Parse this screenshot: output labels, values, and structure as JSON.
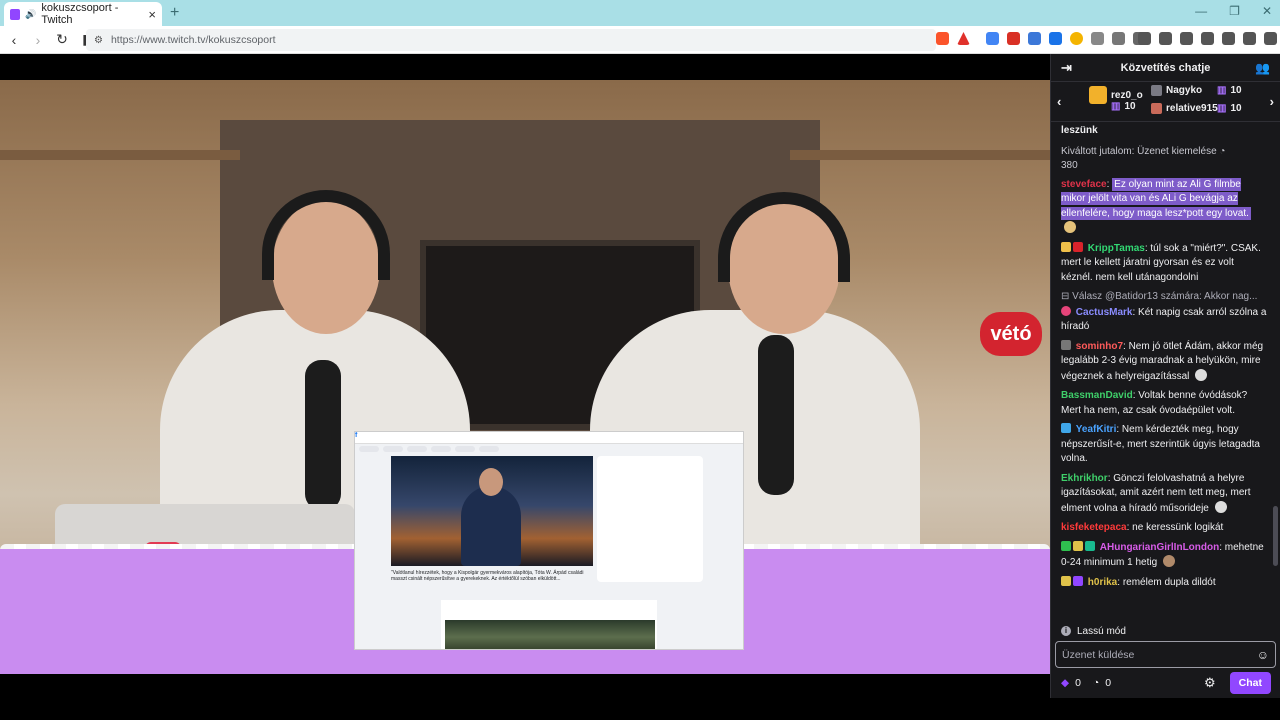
{
  "browser": {
    "tab_title": "kokuszcsoport - Twitch",
    "tab_close": "×",
    "new_tab": "+",
    "url": "https://www.twitch.tv/kokuszcsoport",
    "window_controls": [
      "—",
      "❐",
      "✕"
    ]
  },
  "video": {
    "veto_sign": "vétó",
    "share_brand": "f",
    "share_caption": "\"Valótlanul hírezzétek, hogy a Kispolgár gyermekváros alapítója, Tóta W. Árpád családi masszt csinált népszerűsítve a gyerekeknek. Az értéktőlül szóban elküldött..."
  },
  "chat": {
    "header_title": "Közvetítés chatje",
    "gifts": [
      {
        "name": "rez0_o",
        "count": "10"
      },
      {
        "name": "Nagyko",
        "count": "10"
      },
      {
        "name": "relative915",
        "count": "10"
      }
    ],
    "messages_top_fragment": "leszünk",
    "reward_label": "Kiváltott jutalom: Üzenet kiemelése",
    "reward_cost": "380",
    "messages": [
      {
        "user": "steveface",
        "color": "#e0334a",
        "text": "Ez olyan mint az Ali G filmbe mikor jelölt vita van és ALi G bevágja az ellenfelére, hogy maga lesz*pott egy lovat.",
        "highlight": true
      },
      {
        "user": "KrippTamas",
        "color": "#32d873",
        "text": "túl sok a \"miért?\". CSAK. mert le kellett járatni gyorsan és ez volt kéznél. nem kell utánagondolni"
      },
      {
        "reply": "Válasz @Batidor13 számára: Akkor nag..."
      },
      {
        "user": "CactusMark",
        "color": "#8a8cff",
        "text": "Két napig csak arról szólna a híradó"
      },
      {
        "user": "sominho7",
        "color": "#ff5a5a",
        "text": "Nem jó ötlet Ádám, akkor még legalább 2-3 évig maradnak a helyükön, mire végeznek a helyreigazítással"
      },
      {
        "user": "BassmanDavid",
        "color": "#3fcf6a",
        "text": "Voltak benne óvódások? Mert ha nem, az csak óvodaépület volt."
      },
      {
        "user": "YeafKitri",
        "color": "#4aa3ff",
        "text": "Nem kérdezték meg, hogy népszerűsít-e, mert szerintük úgyis letagadta volna."
      },
      {
        "user": "Ekhrikhor",
        "color": "#3fcf6a",
        "text": "Gönczi felolvashatná a helyre igazításokat, amit azért nem tett meg, mert elment volna a híradó műsorideje"
      },
      {
        "user": "kisfeketepaca",
        "color": "#ff3a3a",
        "text": "ne keressünk logikát"
      },
      {
        "user": "AHungarianGirlInLondon",
        "color": "#d75ce8",
        "text": "mehetne 0-24 minimum 1 hetig"
      },
      {
        "user": "h0rika",
        "color": "#e0c24a",
        "text": "remélem dupla dildót"
      }
    ],
    "slow_mode": "Lassú mód",
    "input_placeholder": "Üzenet küldése",
    "points": "0",
    "bits": "0",
    "chat_button": "Chat"
  }
}
